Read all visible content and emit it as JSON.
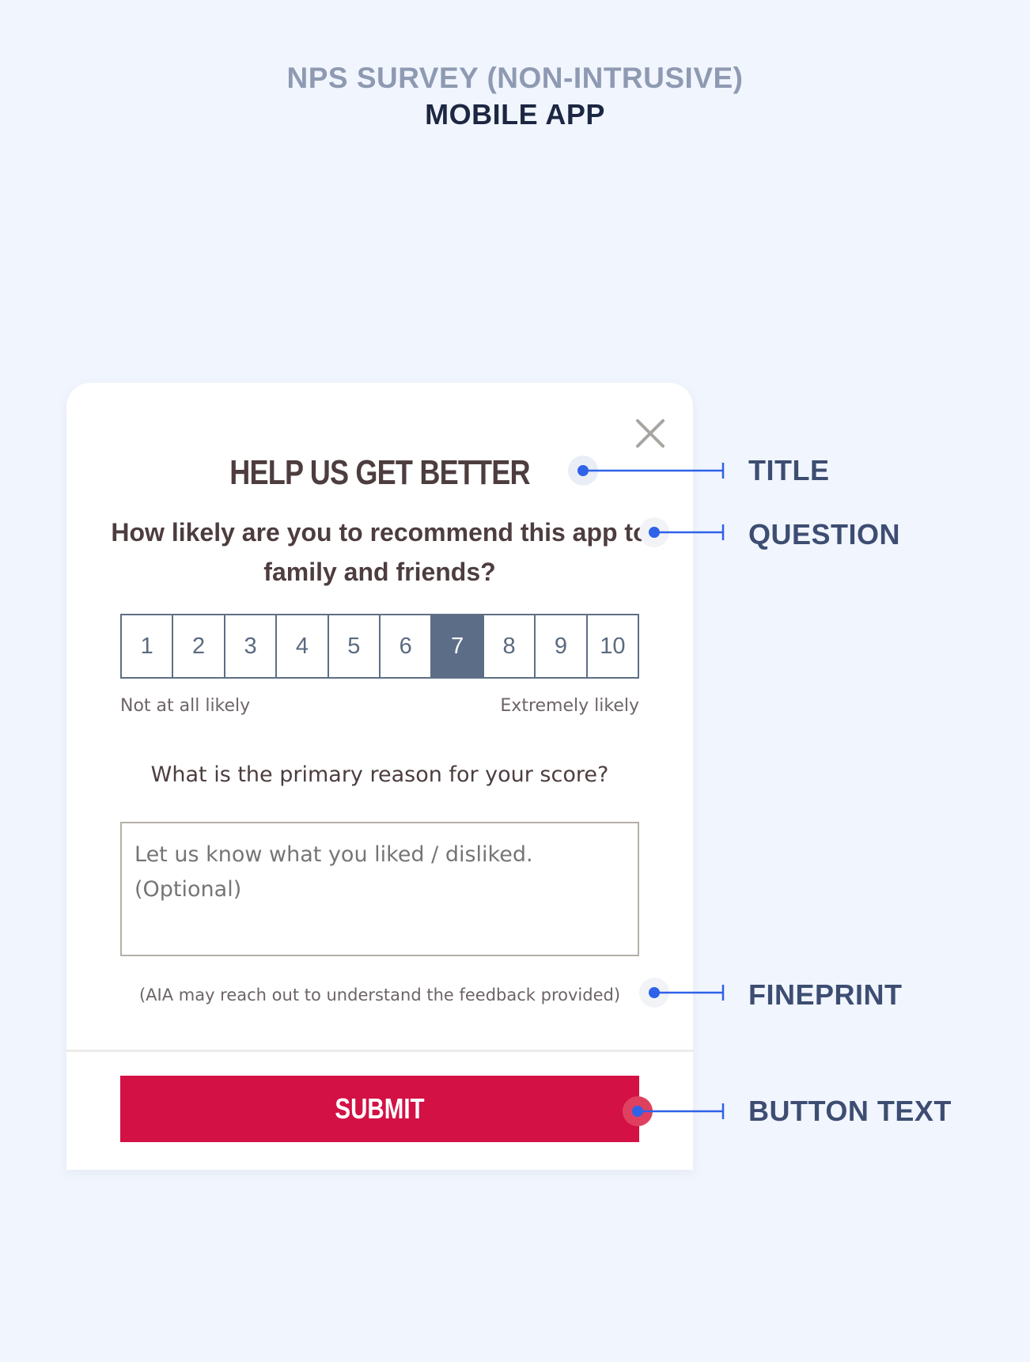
{
  "header": {
    "line1": "NPS SURVEY (NON-INTRUSIVE)",
    "line2": "MOBILE APP"
  },
  "survey": {
    "close_icon": "close-icon",
    "title": "HELP US GET BETTER",
    "question": "How likely are you to recommend this app to family and friends?",
    "scale": {
      "options": [
        "1",
        "2",
        "3",
        "4",
        "5",
        "6",
        "7",
        "8",
        "9",
        "10"
      ],
      "selected": "7",
      "min_label": "Not at all likely",
      "max_label": "Extremely likely"
    },
    "reason_question": "What is the primary reason for your score?",
    "feedback": {
      "value": "",
      "placeholder": "Let us know what you liked / disliked. (Optional)"
    },
    "fineprint": "(AIA may reach out to understand the feedback provided)",
    "submit_label": "SUBMIT"
  },
  "annotations": {
    "title": "TITLE",
    "question": "QUESTION",
    "fineprint": "FINEPRINT",
    "button_text": "BUTTON TEXT"
  },
  "colors": {
    "background": "#f1f5fd",
    "text_dark": "#4d3d3f",
    "scale_selected": "#5c6e87",
    "submit_bg": "#d31145",
    "annotation_line": "#2f62e8",
    "annotation_label": "#3d4d72"
  }
}
